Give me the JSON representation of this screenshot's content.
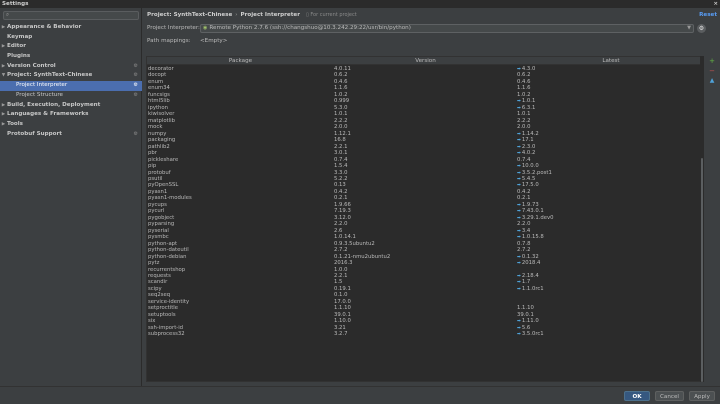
{
  "window": {
    "title": "Settings",
    "close": "×"
  },
  "search": {
    "value": "",
    "placeholder": ""
  },
  "sidebar": {
    "items": [
      {
        "label": "Appearance & Behavior",
        "arrow": "▶",
        "cfg": "",
        "child": false,
        "selected": false
      },
      {
        "label": "Keymap",
        "arrow": "",
        "cfg": "",
        "child": false,
        "selected": false
      },
      {
        "label": "Editor",
        "arrow": "▶",
        "cfg": "",
        "child": false,
        "selected": false
      },
      {
        "label": "Plugins",
        "arrow": "",
        "cfg": "",
        "child": false,
        "selected": false
      },
      {
        "label": "Version Control",
        "arrow": "▶",
        "cfg": "⚙",
        "child": false,
        "selected": false
      },
      {
        "label": "Project: SynthText-Chinese",
        "arrow": "▼",
        "cfg": "⚙",
        "child": false,
        "selected": false
      },
      {
        "label": "Project Interpreter",
        "arrow": "",
        "cfg": "⚙",
        "child": true,
        "selected": true
      },
      {
        "label": "Project Structure",
        "arrow": "",
        "cfg": "⚙",
        "child": true,
        "selected": false
      },
      {
        "label": "Build, Execution, Deployment",
        "arrow": "▶",
        "cfg": "",
        "child": false,
        "selected": false
      },
      {
        "label": "Languages & Frameworks",
        "arrow": "▶",
        "cfg": "",
        "child": false,
        "selected": false
      },
      {
        "label": "Tools",
        "arrow": "▶",
        "cfg": "",
        "child": false,
        "selected": false
      },
      {
        "label": "Protobuf Support",
        "arrow": "",
        "cfg": "⚙",
        "child": false,
        "selected": false
      }
    ]
  },
  "breadcrumb": {
    "project": "Project: SynthText-Chinese",
    "sep": "›",
    "page": "Project Interpreter",
    "note": "For current project"
  },
  "reset_label": "Reset",
  "interpreter": {
    "label": "Project Interpreter:",
    "value": "Remote Python 2.7.6 (ssh://changshuo@10.3.242.29:22/usr/bin/python)"
  },
  "path_mappings": {
    "label": "Path mappings:",
    "value": "<Empty>"
  },
  "table": {
    "headers": {
      "package": "Package",
      "version": "Version",
      "latest": "Latest"
    },
    "upgrade_glyph": "➡",
    "rows": [
      {
        "package": "decorator",
        "version": "4.0.11",
        "latest": "4.3.0",
        "upgrade": true
      },
      {
        "package": "docopt",
        "version": "0.6.2",
        "latest": "0.6.2",
        "upgrade": false
      },
      {
        "package": "enum",
        "version": "0.4.6",
        "latest": "0.4.6",
        "upgrade": false
      },
      {
        "package": "enum34",
        "version": "1.1.6",
        "latest": "1.1.6",
        "upgrade": false
      },
      {
        "package": "funcsigs",
        "version": "1.0.2",
        "latest": "1.0.2",
        "upgrade": false
      },
      {
        "package": "html5lib",
        "version": "0.999",
        "latest": "1.0.1",
        "upgrade": true
      },
      {
        "package": "ipython",
        "version": "5.3.0",
        "latest": "6.3.1",
        "upgrade": true
      },
      {
        "package": "kiwisolver",
        "version": "1.0.1",
        "latest": "1.0.1",
        "upgrade": false
      },
      {
        "package": "matplotlib",
        "version": "2.2.2",
        "latest": "2.2.2",
        "upgrade": false
      },
      {
        "package": "mock",
        "version": "2.0.0",
        "latest": "2.0.0",
        "upgrade": false
      },
      {
        "package": "numpy",
        "version": "1.12.1",
        "latest": "1.14.2",
        "upgrade": true
      },
      {
        "package": "packaging",
        "version": "16.8",
        "latest": "17.1",
        "upgrade": true
      },
      {
        "package": "pathlib2",
        "version": "2.2.1",
        "latest": "2.3.0",
        "upgrade": true
      },
      {
        "package": "pbr",
        "version": "3.0.1",
        "latest": "4.0.2",
        "upgrade": true
      },
      {
        "package": "pickleshare",
        "version": "0.7.4",
        "latest": "0.7.4",
        "upgrade": false
      },
      {
        "package": "pip",
        "version": "1.5.4",
        "latest": "10.0.0",
        "upgrade": true
      },
      {
        "package": "protobuf",
        "version": "3.3.0",
        "latest": "3.5.2.post1",
        "upgrade": true
      },
      {
        "package": "psutil",
        "version": "5.2.2",
        "latest": "5.4.5",
        "upgrade": true
      },
      {
        "package": "pyOpenSSL",
        "version": "0.13",
        "latest": "17.5.0",
        "upgrade": true
      },
      {
        "package": "pyasn1",
        "version": "0.4.2",
        "latest": "0.4.2",
        "upgrade": false
      },
      {
        "package": "pyasn1-modules",
        "version": "0.2.1",
        "latest": "0.2.1",
        "upgrade": false
      },
      {
        "package": "pycups",
        "version": "1.9.66",
        "latest": "1.9.73",
        "upgrade": true
      },
      {
        "package": "pycurl",
        "version": "7.19.3",
        "latest": "7.43.0.1",
        "upgrade": true
      },
      {
        "package": "pygobject",
        "version": "3.12.0",
        "latest": "3.29.1.dev0",
        "upgrade": true
      },
      {
        "package": "pyparsing",
        "version": "2.2.0",
        "latest": "2.2.0",
        "upgrade": false
      },
      {
        "package": "pyserial",
        "version": "2.6",
        "latest": "3.4",
        "upgrade": true
      },
      {
        "package": "pysmbc",
        "version": "1.0.14.1",
        "latest": "1.0.15.8",
        "upgrade": true
      },
      {
        "package": "python-apt",
        "version": "0.9.3.5ubuntu2",
        "latest": "0.7.8",
        "upgrade": false
      },
      {
        "package": "python-dateutil",
        "version": "2.7.2",
        "latest": "2.7.2",
        "upgrade": false
      },
      {
        "package": "python-debian",
        "version": "0.1.21-nmu2ubuntu2",
        "latest": "0.1.32",
        "upgrade": true
      },
      {
        "package": "pytz",
        "version": "2016.3",
        "latest": "2018.4",
        "upgrade": true
      },
      {
        "package": "recurrentshop",
        "version": "1.0.0",
        "latest": "",
        "upgrade": false
      },
      {
        "package": "requests",
        "version": "2.2.1",
        "latest": "2.18.4",
        "upgrade": true
      },
      {
        "package": "scandir",
        "version": "1.5",
        "latest": "1.7",
        "upgrade": true
      },
      {
        "package": "scipy",
        "version": "0.19.1",
        "latest": "1.1.0rc1",
        "upgrade": true
      },
      {
        "package": "seq2seq",
        "version": "0.1.0",
        "latest": "",
        "upgrade": false
      },
      {
        "package": "service-identity",
        "version": "17.0.0",
        "latest": "",
        "upgrade": false
      },
      {
        "package": "setproctitle",
        "version": "1.1.10",
        "latest": "1.1.10",
        "upgrade": false
      },
      {
        "package": "setuptools",
        "version": "39.0.1",
        "latest": "39.0.1",
        "upgrade": false
      },
      {
        "package": "six",
        "version": "1.10.0",
        "latest": "1.11.0",
        "upgrade": true
      },
      {
        "package": "ssh-import-id",
        "version": "3.21",
        "latest": "5.6",
        "upgrade": true
      },
      {
        "package": "subprocess32",
        "version": "3.2.7",
        "latest": "3.5.0rc1",
        "upgrade": true
      }
    ]
  },
  "tools": {
    "add": "+",
    "remove": "−",
    "upgrade": "▲"
  },
  "footer": {
    "ok": "OK",
    "cancel": "Cancel",
    "apply": "Apply",
    "help": "?"
  }
}
